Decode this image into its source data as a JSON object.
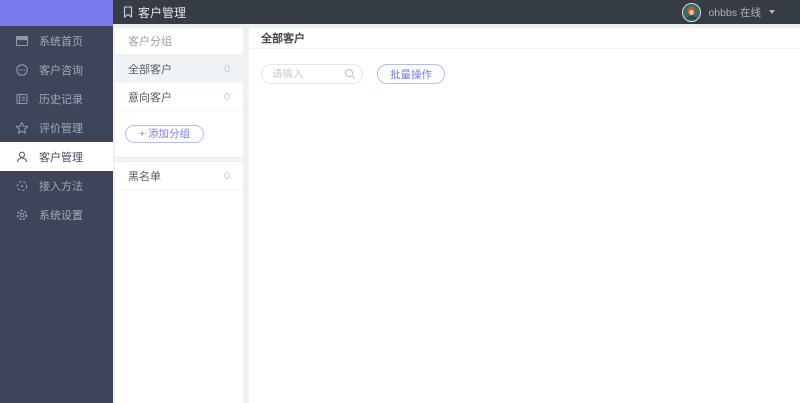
{
  "header": {
    "title": "客户管理",
    "title_icon": "bookmark-icon",
    "user": {
      "name": "ohbbs",
      "status": "在线",
      "avatar": "avatar-person",
      "caret_icon": "caret-down-icon"
    }
  },
  "sidebar": {
    "items": [
      {
        "label": "系统首页",
        "icon": "window-icon",
        "active": false
      },
      {
        "label": "客户咨询",
        "icon": "chat-circle-icon",
        "active": false
      },
      {
        "label": "历史记录",
        "icon": "notebook-icon",
        "active": false
      },
      {
        "label": "评价管理",
        "icon": "star-icon",
        "active": false
      },
      {
        "label": "客户管理",
        "icon": "user-icon",
        "active": true
      },
      {
        "label": "接入方法",
        "icon": "plugin-icon",
        "active": false
      },
      {
        "label": "系统设置",
        "icon": "gear-icon",
        "active": false
      }
    ]
  },
  "groups_panel": {
    "title": "客户分组",
    "items": [
      {
        "label": "全部客户",
        "count": "0",
        "selected": true
      },
      {
        "label": "意向客户",
        "count": "0",
        "selected": false
      }
    ],
    "add_button_label": "+ 添加分组",
    "blacklist": {
      "label": "黑名单",
      "count": "0"
    }
  },
  "main": {
    "title": "全部客户",
    "search_placeholder": "请输入",
    "search_icon": "search-icon",
    "batch_button_label": "批量操作"
  },
  "colors": {
    "accent": "#7a7bec",
    "sidebar_bg": "#3e455b",
    "header_bg": "#363c43",
    "selected_row_bg": "#eef3f8",
    "avatar_bg": "#356e67"
  }
}
